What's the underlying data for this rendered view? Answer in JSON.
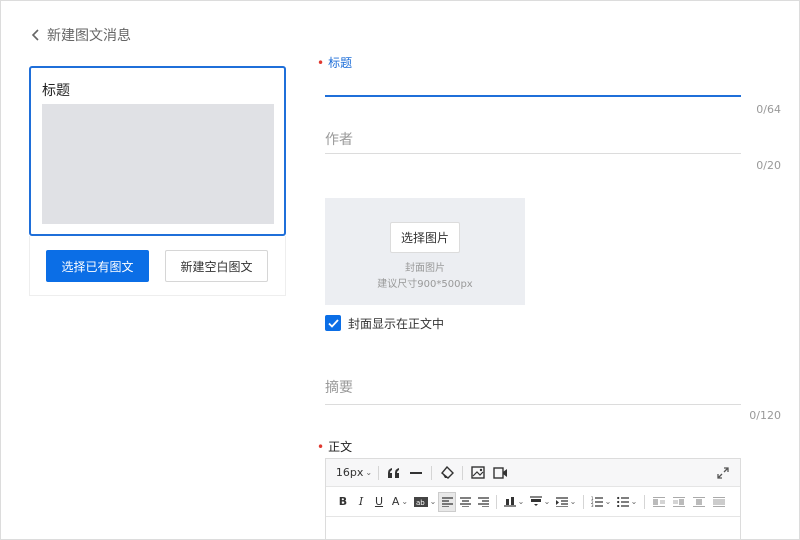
{
  "header": {
    "back_label": "新建图文消息"
  },
  "preview": {
    "title": "标题",
    "select_existing_button": "选择已有图文",
    "new_blank_button": "新建空白图文"
  },
  "form": {
    "title": {
      "label": "标题",
      "required_mark": "•",
      "value": "",
      "counter": "0/64"
    },
    "author": {
      "placeholder": "作者",
      "counter": "0/20"
    },
    "cover": {
      "button_label": "选择图片",
      "hint_title": "封面图片",
      "hint_size": "建议尺寸900*500px"
    },
    "show_cover_checkbox": {
      "label": "封面显示在正文中",
      "checked": true
    },
    "summary": {
      "placeholder": "摘要",
      "counter": "0/120"
    },
    "body": {
      "label": "正文",
      "required_mark": "•"
    }
  },
  "editor": {
    "font_size": "16px",
    "tools_row1": [
      "quote-icon",
      "horizontal-rule-icon",
      "clear-format-icon",
      "image-icon",
      "video-icon",
      "fullscreen-icon"
    ],
    "tools_row2": [
      "bold-icon",
      "italic-icon",
      "underline-icon",
      "font-color-icon",
      "background-color-icon",
      "align-left-icon",
      "align-center-icon",
      "align-right-icon",
      "paragraph-spacing-icon",
      "line-height-icon",
      "indent-icon",
      "ordered-list-icon",
      "unordered-list-icon",
      "float-left-icon",
      "float-none-icon",
      "float-center-icon",
      "float-right-icon"
    ]
  },
  "colors": {
    "primary": "#0b6ee6",
    "active_border": "#1f6fd9",
    "required": "#e0382f"
  }
}
